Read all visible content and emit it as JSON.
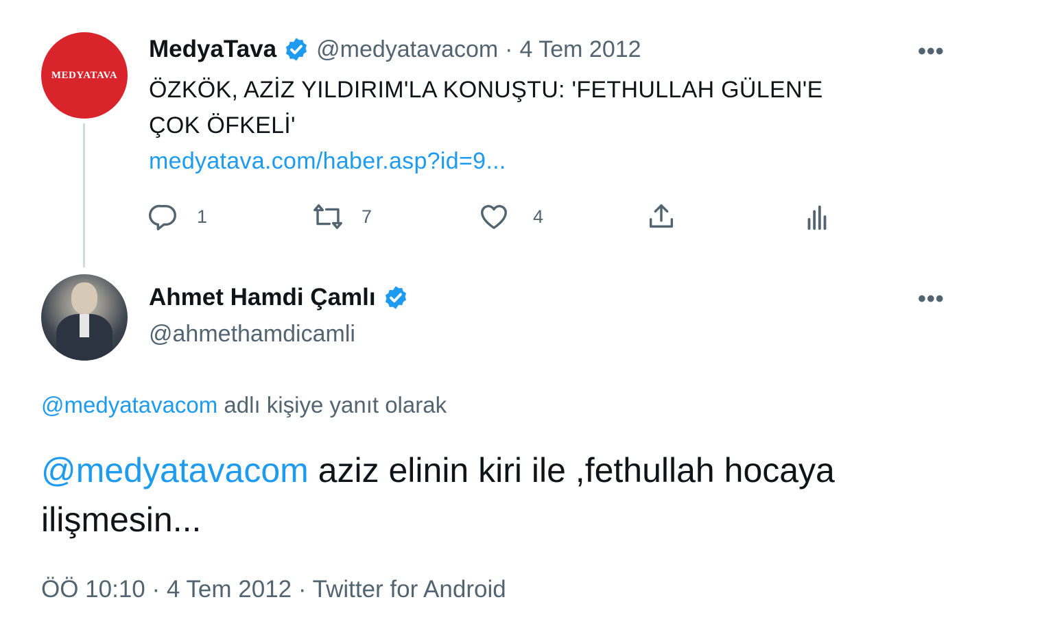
{
  "parent_tweet": {
    "avatar_text": "MEDYATAVA",
    "display_name": "MedyaTava",
    "handle": "@medyatavacom",
    "separator": "·",
    "date": "4 Tem 2012",
    "text_line1": "ÖZKÖK, AZİZ YILDIRIM'LA KONUŞTU: 'FETHULLAH GÜLEN'E",
    "text_line2": "ÇOK ÖFKELİ'",
    "link": "medyatava.com/haber.asp?id=9...",
    "more": "•••",
    "actions": {
      "reply_count": "1",
      "retweet_count": "7",
      "like_count": "4"
    }
  },
  "main_tweet": {
    "display_name": "Ahmet Hamdi Çamlı",
    "handle": "@ahmethamdicamli",
    "more": "•••",
    "reply_to_handle": "@medyatavacom",
    "reply_to_suffix": " adlı kişiye yanıt olarak",
    "mention": "@medyatavacom",
    "text_rest": " aziz elinin kiri ile ,fethullah hocaya ilişmesin...",
    "time": "ÖÖ 10:10",
    "separator1": " · ",
    "date": "4 Tem 2012",
    "separator2": " · ",
    "source": "Twitter for Android"
  },
  "colors": {
    "accent": "#1d9bf0",
    "secondary_text": "#536471",
    "brand_red": "#d9242b"
  },
  "icons": [
    "verified-badge-icon",
    "more-icon",
    "reply-icon",
    "retweet-icon",
    "like-icon",
    "share-icon",
    "analytics-icon"
  ]
}
